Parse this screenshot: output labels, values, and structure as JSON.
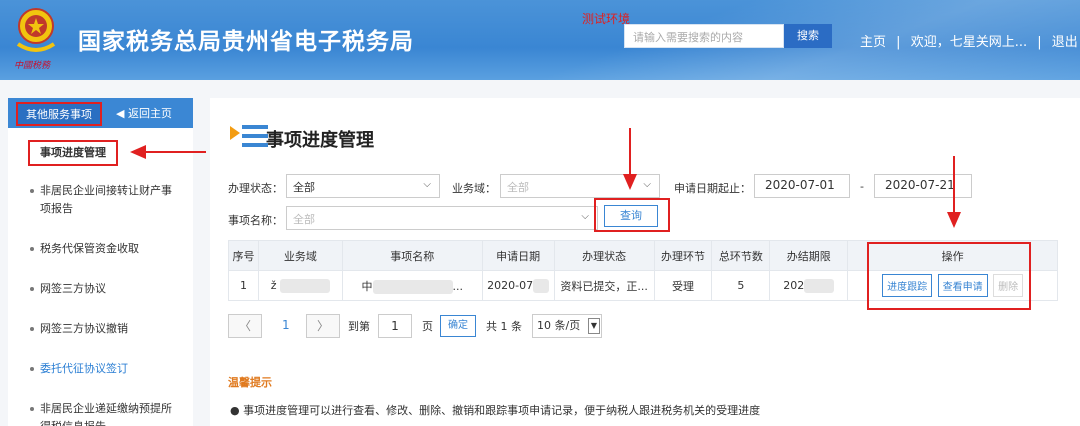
{
  "header": {
    "title": "国家税务总局贵州省电子税务局",
    "emblem_caption": "中國税務",
    "test_env": "测试环境",
    "search_placeholder": "请输入需要搜索的内容",
    "search_button": "搜索",
    "nav_home": "主页",
    "nav_sep": "|",
    "nav_welcome": "欢迎，七星关网上...",
    "nav_logout": "退出"
  },
  "sidebar": {
    "tab_label": "其他服务事项",
    "back_label": "返回主页",
    "items": [
      {
        "label": "事项进度管理"
      },
      {
        "label": "非居民企业间接转让财产事项报告"
      },
      {
        "label": "税务代保管资金收取"
      },
      {
        "label": "网签三方协议"
      },
      {
        "label": "网签三方协议撤销"
      },
      {
        "label": "委托代征协议签订"
      },
      {
        "label": "非居民企业递延缴纳预提所得税信息报告"
      }
    ]
  },
  "page": {
    "title": "事项进度管理"
  },
  "filters": {
    "status_label": "办理状态：",
    "status_value": "全部",
    "domain_label": "业务域：",
    "domain_placeholder": "全部",
    "date_label": "申请日期起止：",
    "date_from": "2020-07-01",
    "date_sep": "-",
    "date_to": "2020-07-21",
    "name_label": "事项名称：",
    "name_placeholder": "全部",
    "query_button": "查询"
  },
  "table": {
    "headers": [
      "序号",
      "业务域",
      "事项名称",
      "申请日期",
      "办理状态",
      "办理环节",
      "总环节数",
      "办结期限",
      "操作"
    ],
    "rows": [
      {
        "index": "1",
        "domain": "ž",
        "name": "中",
        "name_tail": "...",
        "date": "2020-07",
        "status": "资料已提交，正...",
        "step": "受理",
        "total_steps": "5",
        "deadline": "202",
        "op_track": "进度跟踪",
        "op_view": "查看申请",
        "op_delete": "删除"
      }
    ]
  },
  "pager": {
    "prev": "〈",
    "current": "1",
    "next": "〉",
    "goto_label": "到第",
    "goto_value": "1",
    "page_unit": "页",
    "confirm": "确定",
    "total": "共 1 条",
    "per_page": "10 条/页"
  },
  "tips": {
    "title": "温馨提示",
    "line1": "事项进度管理可以进行查看、修改、删除、撤销和跟踪事项申请记录，便于纳税人跟进税务机关的受理进度"
  },
  "colors": {
    "header_blue": "#3a86d3",
    "accent_blue": "#3a86d3",
    "highlight_red": "#e02020",
    "tips_orange": "#e07a1f"
  }
}
